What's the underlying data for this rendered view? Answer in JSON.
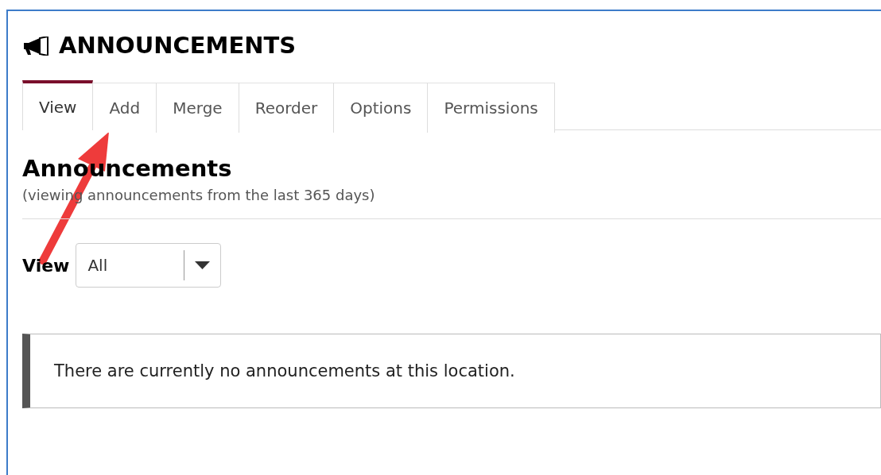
{
  "page": {
    "title": "ANNOUNCEMENTS"
  },
  "tabs": [
    {
      "label": "View",
      "selected": true
    },
    {
      "label": "Add",
      "selected": false
    },
    {
      "label": "Merge",
      "selected": false
    },
    {
      "label": "Reorder",
      "selected": false
    },
    {
      "label": "Options",
      "selected": false
    },
    {
      "label": "Permissions",
      "selected": false
    }
  ],
  "section": {
    "heading": "Announcements",
    "subtitle": "(viewing announcements from the last 365 days)"
  },
  "view_filter": {
    "label": "View",
    "value": "All"
  },
  "message": "There are currently no announcements at this location."
}
